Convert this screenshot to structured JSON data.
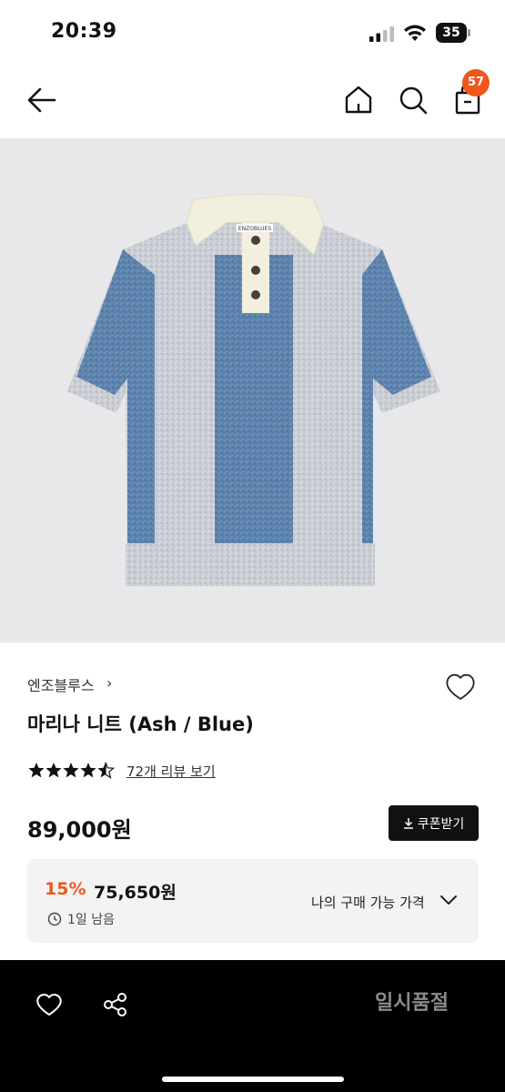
{
  "status": {
    "time": "20:39",
    "battery": "35"
  },
  "nav": {
    "cart_count": "57"
  },
  "product": {
    "brand": "엔조블루스",
    "title": "마리나 니트 (Ash / Blue)",
    "rating": 4.5,
    "review_text": "72개 리뷰 보기",
    "price": "89,000원",
    "coupon_label": "쿠폰받기",
    "image_brand_tag": "ENZOBLUES"
  },
  "benefit": {
    "discount_rate": "15%",
    "discount_price": "75,650원",
    "time_left": "1일 남음",
    "my_price_label": "나의 구매 가능 가격"
  },
  "bottom": {
    "soldout_label": "일시품절"
  },
  "colors": {
    "accent": "#f0561d",
    "knit_blue": "#5b82ad",
    "knit_grey": "#c9cdd3",
    "collar_cream": "#f3efdf",
    "image_bg": "#e8e8ea"
  }
}
